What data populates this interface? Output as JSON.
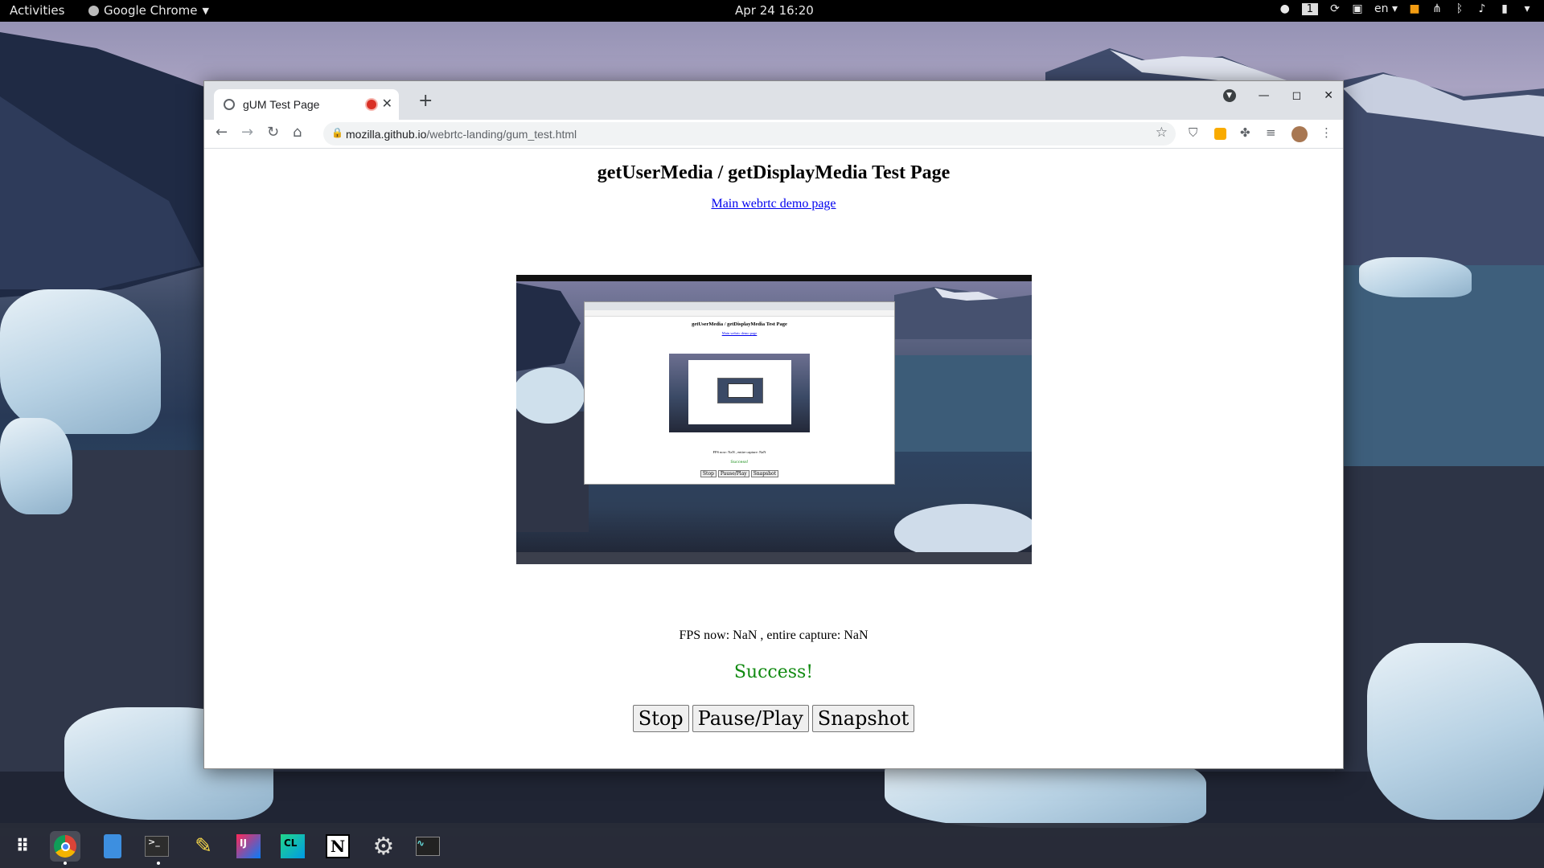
{
  "topbar": {
    "activities": "Activities",
    "app_name": "Google Chrome",
    "clock": "Apr 24  16:20",
    "workspace": "1",
    "keyboard_layout": "en"
  },
  "browser": {
    "tab_title": "gUM Test Page",
    "url_host": "mozilla.github.io",
    "url_path": "/webrtc-landing/gum_test.html"
  },
  "page": {
    "title": "getUserMedia / getDisplayMedia Test Page",
    "link_text": "Main webrtc demo page",
    "fps_text": "FPS now: NaN , entire capture: NaN",
    "status": "Success!",
    "buttons": {
      "stop": "Stop",
      "pause_play": "Pause/Play",
      "snapshot": "Snapshot"
    }
  },
  "colors": {
    "success": "#108a10",
    "link": "#0000ee",
    "recording": "#d93025"
  },
  "taskbar": {
    "apps": [
      "app-grid-icon",
      "chrome-icon",
      "files-icon",
      "terminal-icon",
      "notes-icon",
      "intellij-icon",
      "clion-icon",
      "notion-icon",
      "settings-icon",
      "system-monitor-icon"
    ]
  }
}
